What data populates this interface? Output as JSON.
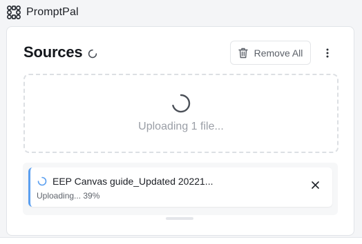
{
  "app": {
    "title": "PromptPal"
  },
  "sources": {
    "title": "Sources",
    "remove_all_label": "Remove All",
    "dropzone_text": "Uploading 1 file...",
    "files": [
      {
        "name": "EEP Canvas guide_Updated 20221...",
        "status": "Uploading... 39%",
        "progress_percent": 39
      }
    ]
  },
  "colors": {
    "accent": "#5a9ff0",
    "spinner": "#4a4f57",
    "muted_text": "#9a9ea6"
  },
  "icons": [
    "app-logo-icon",
    "loading-spinner-icon",
    "trash-icon",
    "more-vertical-icon",
    "close-icon"
  ]
}
